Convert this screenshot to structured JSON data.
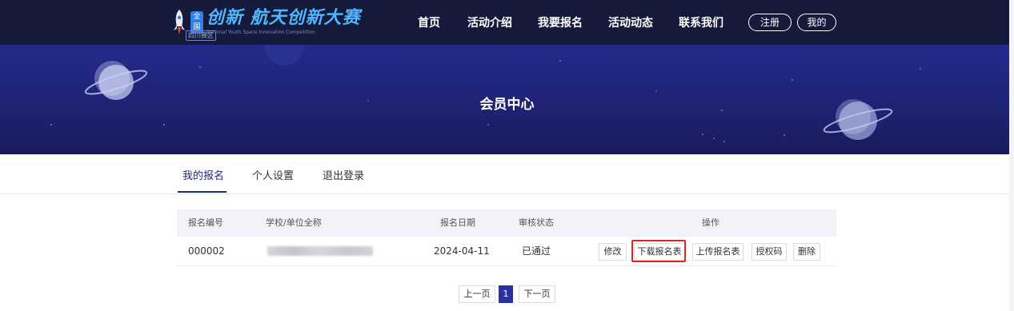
{
  "header": {
    "logo": {
      "badge": "全国",
      "title": "创新 航天创新大赛",
      "subtitle": "National Youth Space Innovation Competition",
      "region": "四川赛区"
    },
    "nav": [
      "首页",
      "活动介绍",
      "我要报名",
      "活动动态",
      "联系我们"
    ],
    "register_label": "注册",
    "mine_label": "我的"
  },
  "hero": {
    "title": "会员中心"
  },
  "tabs": [
    "我的报名",
    "个人设置",
    "退出登录"
  ],
  "table": {
    "columns": [
      "报名编号",
      "学校/单位全称",
      "报名日期",
      "审核状态",
      "操作"
    ],
    "rows": [
      {
        "id": "000002",
        "school": "",
        "date": "2024-04-11",
        "status": "已通过",
        "actions": [
          "修改",
          "下载报名表",
          "上传报名表",
          "授权码",
          "删除"
        ]
      }
    ]
  },
  "pagination": {
    "prev": "上一页",
    "current": "1",
    "next": "下一页"
  },
  "colors": {
    "header_bg": "#151a3a",
    "hero_bg": "#232a8a",
    "accent": "#2a2fa8",
    "highlight": "#e0261c"
  }
}
